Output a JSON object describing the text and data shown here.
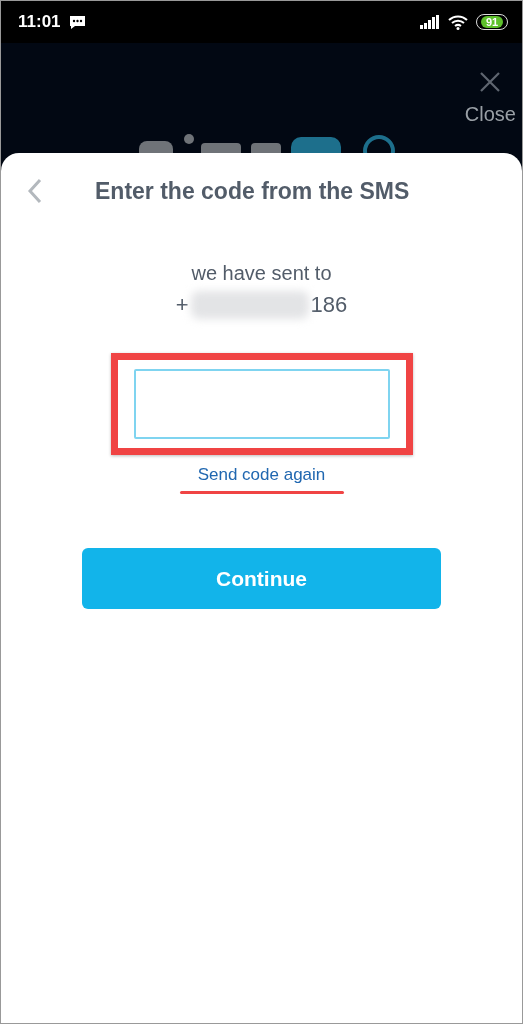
{
  "status_bar": {
    "time": "11:01",
    "battery": "91"
  },
  "background": {
    "close_label": "Close"
  },
  "sheet": {
    "title": "Enter the code from the SMS",
    "sent_to": "we have sent to",
    "phone_prefix": "+",
    "phone_suffix": "186",
    "phone_redacted": true,
    "code_field": {
      "highlighted": true
    },
    "resend_link": {
      "label": "Send code again",
      "underlined": true
    },
    "continue_button": "Continue"
  }
}
